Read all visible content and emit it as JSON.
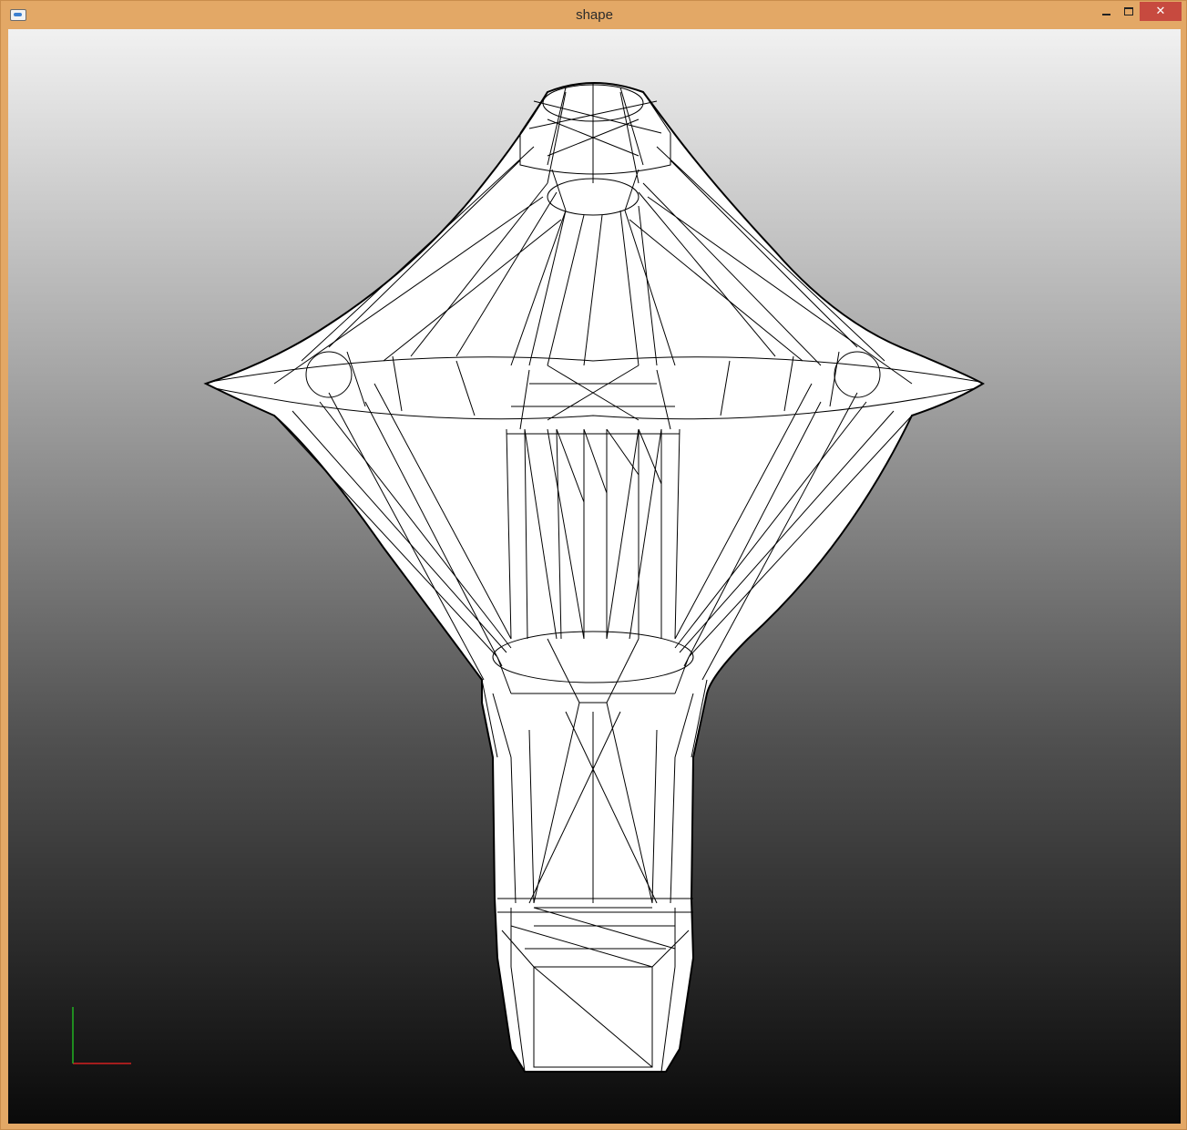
{
  "window": {
    "title": "shape",
    "close_glyph": "✕"
  },
  "viewport": {
    "object": "wireframe-mesh",
    "background_top": "#f1f1f1",
    "background_bottom": "#0a0a0a",
    "axis_x_color": "#d42020",
    "axis_y_color": "#21b321"
  }
}
